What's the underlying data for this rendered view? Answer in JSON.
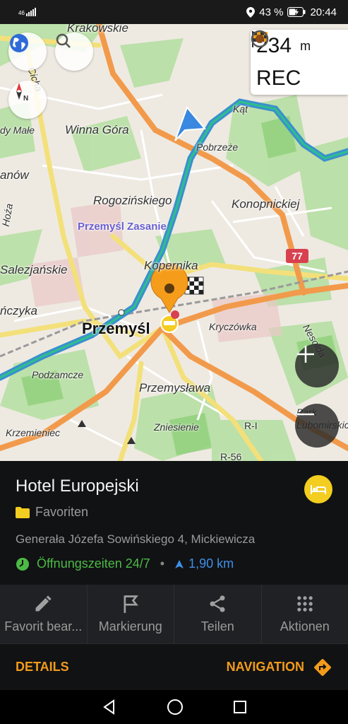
{
  "status_bar": {
    "network": "46",
    "battery": "43 %",
    "time": "20:44"
  },
  "map": {
    "labels": {
      "krakowskie": "Krakowskie",
      "cicha": "Cicha",
      "winna_gora": "Winna Góra",
      "dy_male": "dy Małe",
      "anow": "anów",
      "kat": "Kąt",
      "pobrzeze": "Pobrzeże",
      "rogozinskiego": "Rogozińskiego",
      "konopnickiej": "Konopnickiej",
      "hoza": "Hoża",
      "zasanie": "Przemyśl Zasanie",
      "route_77": "77",
      "salezjanskie": "Salezjańskie",
      "kopernika": "Kopernika",
      "nczyka": "ńczyka",
      "przemysl": "Przemyśl",
      "kryczowka": "Kryczówka",
      "nesolda": "Nesolda",
      "podzamcze": "Podzamcze",
      "przemyslawa": "Przemysława",
      "park_lubomirskich": "Park Lubomirskich",
      "krzemieniec": "Krzemieniec",
      "zniesienie": "Zniesienie",
      "r_i": "R-I",
      "r_56": "R-56"
    },
    "recording": {
      "distance_value": "234",
      "distance_unit": "m",
      "rec_label": "REC"
    },
    "colors": {
      "river": "#3a8fd0",
      "main_road": "#f29a4b",
      "secondary_road": "#f3e27a",
      "green": "#b7e2a5",
      "marker": "#f59d1b"
    }
  },
  "poi": {
    "name": "Hotel Europejski",
    "category": "Favoriten",
    "address": "Generała Józefa Sowińskiego 4, Mickiewicza",
    "hours": "Öffnungszeiten 24/7",
    "separator": "•",
    "distance": "1,90 km"
  },
  "actions": [
    {
      "label": "Favorit bear...",
      "icon": "pencil-icon"
    },
    {
      "label": "Markierung",
      "icon": "flag-icon"
    },
    {
      "label": "Teilen",
      "icon": "share-icon"
    },
    {
      "label": "Aktionen",
      "icon": "grid-icon"
    }
  ],
  "footer": {
    "details": "DETAILS",
    "navigation": "NAVIGATION"
  }
}
